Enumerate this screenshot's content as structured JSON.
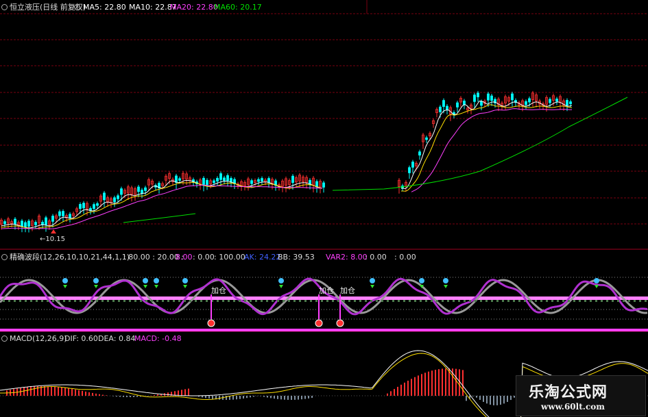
{
  "main_panel": {
    "title": "恒立液压(日线 前复权)",
    "ma5": "MA5: 22.80",
    "ma10": "MA10: 22.87",
    "ma20": "MA20: 22.80",
    "ma60": "MA60: 20.17",
    "low_price_marker": "10.15",
    "colors": {
      "ma5": "#ffffff",
      "ma10": "#ffe000",
      "ma20": "#ff40ff",
      "ma60": "#00e000",
      "up": "#ff3030",
      "down": "#00ffff"
    }
  },
  "indicator_panel": {
    "name": "精确波段(12,26,10,10,21,44,1,1)",
    "params": ": 80.00 : 20.00 :",
    "v1": "8.00",
    "v2": ": 0.00",
    "v3": ": 100.00",
    "ak": "AK: 24.22",
    "bb": "BB: 39.53",
    "var2": "VAR2: 8.00",
    "var2_b": ": 0.00",
    "var2_c": ": 0.00",
    "signals": [
      "加仓",
      "加仓",
      "加仓"
    ]
  },
  "macd_panel": {
    "name": "MACD(12,26,9)",
    "dif": "DIF: 0.60",
    "dea": "DEA: 0.84",
    "macd": "MACD: -0.48"
  },
  "watermark": {
    "title": "乐淘公式网",
    "url": "www.60lt.com"
  }
}
